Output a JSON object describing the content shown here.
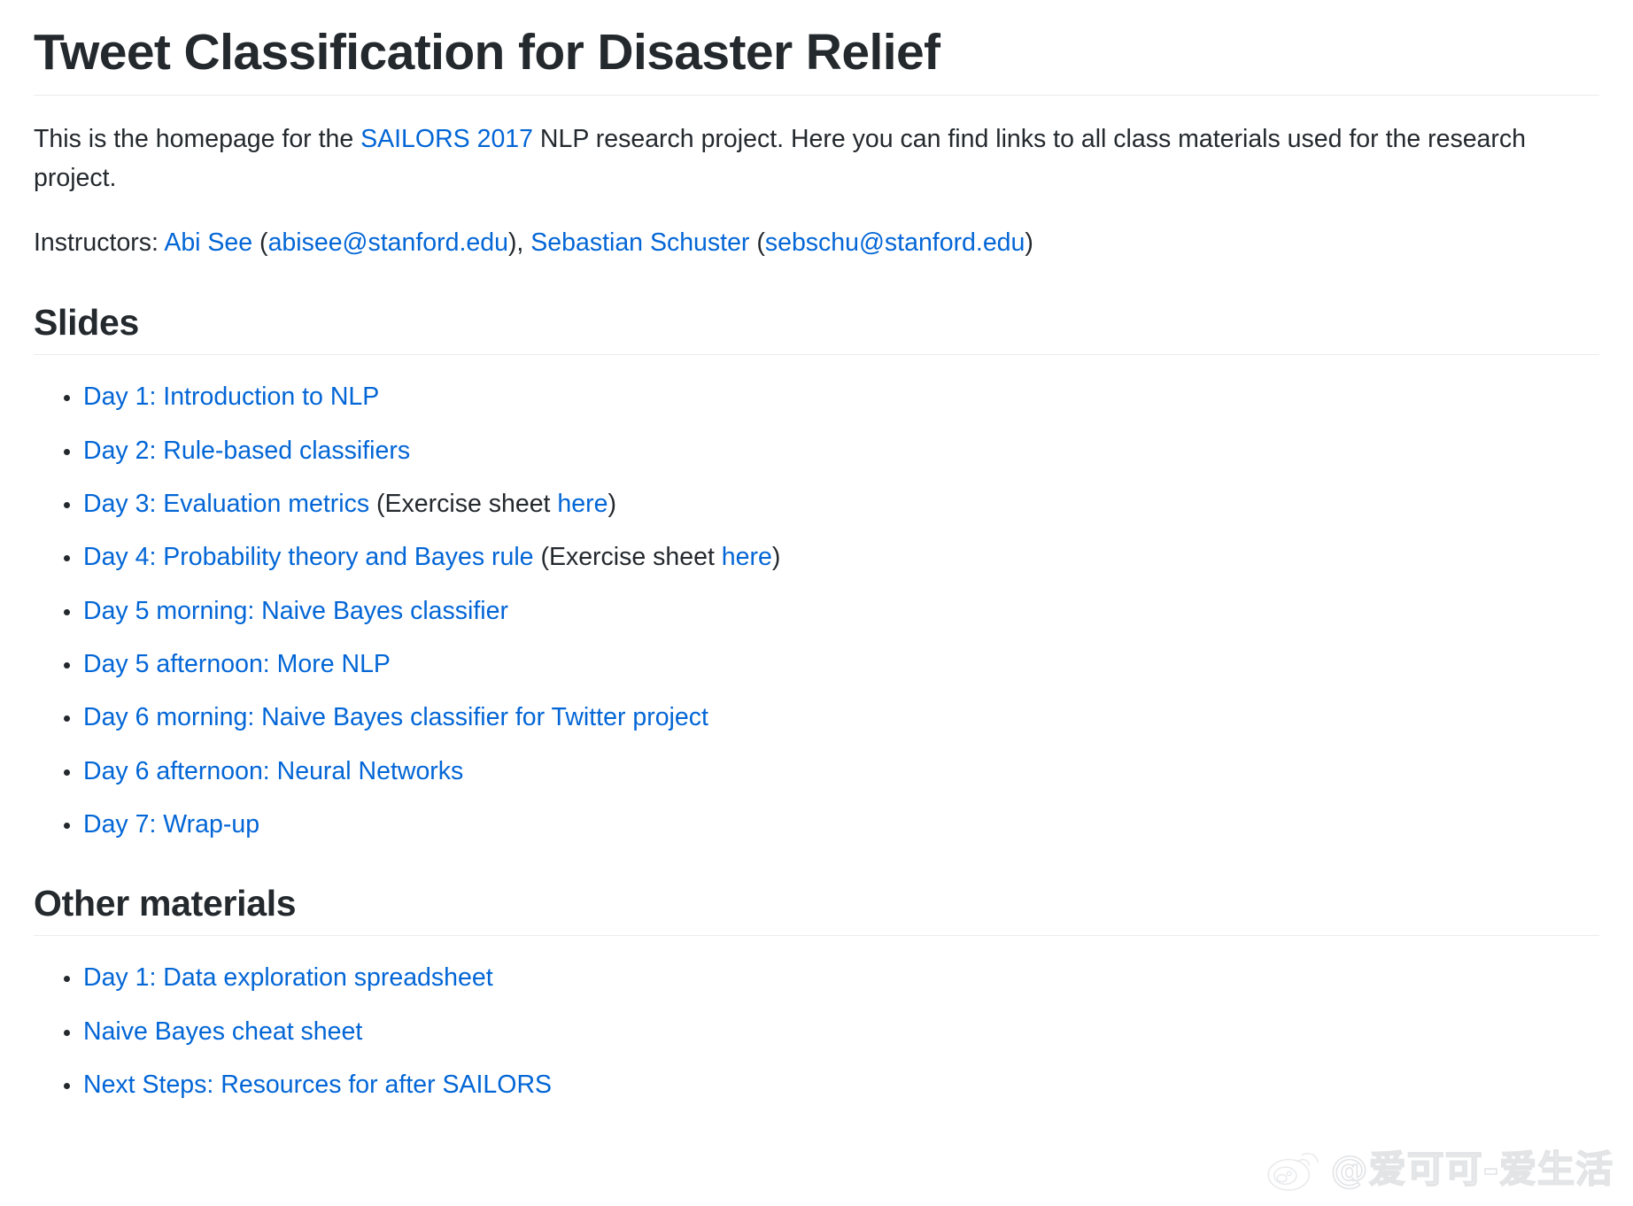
{
  "page": {
    "title": "Tweet Classification for Disaster Relief"
  },
  "intro": {
    "part1": "This is the homepage for the ",
    "link_sailors": "SAILORS 2017",
    "part2": " NLP research project. Here you can find links to all class materials used for the research project."
  },
  "instructors": {
    "label": "Instructors: ",
    "person1": "Abi See",
    "open1": " (",
    "email1": "abisee@stanford.edu",
    "close1": "), ",
    "person2": "Sebastian Schuster",
    "open2": " (",
    "email2": "sebschu@stanford.edu",
    "close2": ")"
  },
  "slides": {
    "heading": "Slides",
    "items": [
      {
        "link": "Day 1: Introduction to NLP",
        "suffix_pre": "",
        "extra_link": "",
        "suffix_post": ""
      },
      {
        "link": "Day 2: Rule-based classifiers",
        "suffix_pre": "",
        "extra_link": "",
        "suffix_post": ""
      },
      {
        "link": "Day 3: Evaluation metrics",
        "suffix_pre": " (Exercise sheet ",
        "extra_link": "here",
        "suffix_post": ")"
      },
      {
        "link": "Day 4: Probability theory and Bayes rule",
        "suffix_pre": " (Exercise sheet ",
        "extra_link": "here",
        "suffix_post": ")"
      },
      {
        "link": "Day 5 morning: Naive Bayes classifier",
        "suffix_pre": "",
        "extra_link": "",
        "suffix_post": ""
      },
      {
        "link": "Day 5 afternoon: More NLP",
        "suffix_pre": "",
        "extra_link": "",
        "suffix_post": ""
      },
      {
        "link": "Day 6 morning: Naive Bayes classifier for Twitter project",
        "suffix_pre": "",
        "extra_link": "",
        "suffix_post": ""
      },
      {
        "link": "Day 6 afternoon: Neural Networks",
        "suffix_pre": "",
        "extra_link": "",
        "suffix_post": ""
      },
      {
        "link": "Day 7: Wrap-up",
        "suffix_pre": "",
        "extra_link": "",
        "suffix_post": ""
      }
    ]
  },
  "other_materials": {
    "heading": "Other materials",
    "items": [
      {
        "link": "Day 1: Data exploration spreadsheet",
        "suffix_pre": "",
        "extra_link": "",
        "suffix_post": ""
      },
      {
        "link": "Naive Bayes cheat sheet",
        "suffix_pre": "",
        "extra_link": "",
        "suffix_post": ""
      },
      {
        "link": "Next Steps: Resources for after SAILORS",
        "suffix_pre": "",
        "extra_link": "",
        "suffix_post": ""
      }
    ]
  },
  "watermark": {
    "text": "@爱可可-爱生活",
    "logo": "weibo-icon"
  },
  "colors": {
    "link": "#0366d6",
    "text": "#24292e",
    "rule": "#eaecef",
    "background": "#ffffff",
    "watermark": "#e3e4e6"
  }
}
